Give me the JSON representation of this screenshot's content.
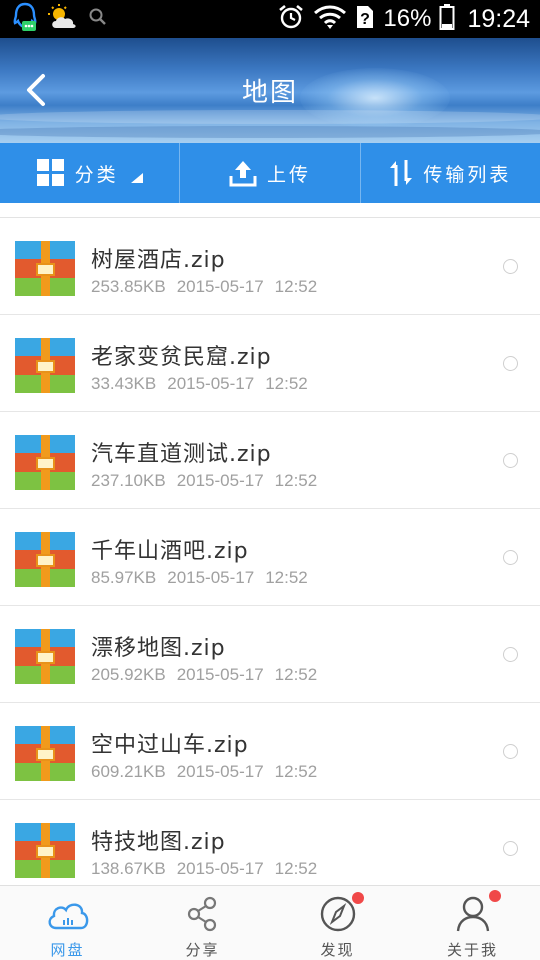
{
  "status_bar": {
    "battery": "16%",
    "time": "19:24"
  },
  "header": {
    "title": "地图"
  },
  "toolbar": {
    "category_label": "分类",
    "upload_label": "上传",
    "transfers_label": "传输列表"
  },
  "files": [
    {
      "name": "树屋酒店.zip",
      "size": "253.85KB",
      "date": "2015-05-17",
      "time": "12:52"
    },
    {
      "name": "老家变贫民窟.zip",
      "size": "33.43KB",
      "date": "2015-05-17",
      "time": "12:52"
    },
    {
      "name": "汽车直道测试.zip",
      "size": "237.10KB",
      "date": "2015-05-17",
      "time": "12:52"
    },
    {
      "name": "千年山酒吧.zip",
      "size": "85.97KB",
      "date": "2015-05-17",
      "time": "12:52"
    },
    {
      "name": "漂移地图.zip",
      "size": "205.92KB",
      "date": "2015-05-17",
      "time": "12:52"
    },
    {
      "name": "空中过山车.zip",
      "size": "609.21KB",
      "date": "2015-05-17",
      "time": "12:52"
    },
    {
      "name": "特技地图.zip",
      "size": "138.67KB",
      "date": "2015-05-17",
      "time": "12:52"
    }
  ],
  "bottom_nav": {
    "items": [
      {
        "label": "网盘",
        "icon": "cloud-icon",
        "active": true
      },
      {
        "label": "分享",
        "icon": "share-icon"
      },
      {
        "label": "发现",
        "icon": "compass-icon",
        "badge": true
      },
      {
        "label": "关于我",
        "icon": "user-icon",
        "badge": true
      }
    ]
  },
  "colors": {
    "accent": "#2f8fe8",
    "nav_active": "#3a98ea",
    "badge": "#f04848",
    "meta_text": "#a0a0a0"
  }
}
